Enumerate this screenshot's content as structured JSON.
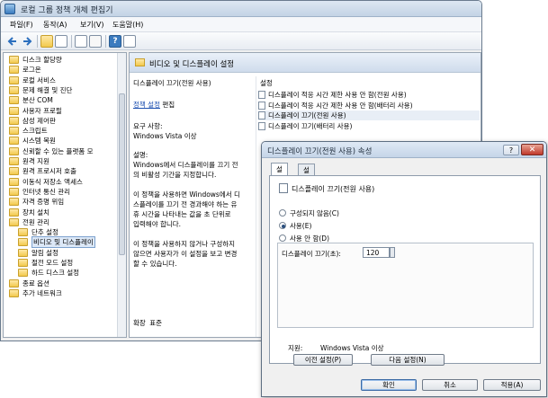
{
  "main_window": {
    "title": "로컬 그룹 정책 개체 편집기",
    "menu": [
      "파일(F)",
      "동작(A)",
      "보기(V)",
      "도움말(H)"
    ]
  },
  "tree": {
    "items": [
      {
        "label": "디스크 할당량"
      },
      {
        "label": "로그온"
      },
      {
        "label": "로컬 서비스"
      },
      {
        "label": "문제 해결 및 진단"
      },
      {
        "label": "분산 COM"
      },
      {
        "label": "사용자 프로필"
      },
      {
        "label": "삼성 제어판"
      },
      {
        "label": "스크립트"
      },
      {
        "label": "시스템 복원"
      },
      {
        "label": "신뢰할 수 있는 플랫폼 모"
      },
      {
        "label": "원격 지원"
      },
      {
        "label": "원격 프로시저 호출"
      },
      {
        "label": "이동식 저장소 액세스"
      },
      {
        "label": "인터넷 통신 관리"
      },
      {
        "label": "자격 증명 위임"
      },
      {
        "label": "장치 설치"
      },
      {
        "label": "전원 관리"
      },
      {
        "label": "단추 설정"
      },
      {
        "label": "비디오 및 디스플레이"
      },
      {
        "label": "알림 설정"
      },
      {
        "label": "절전 모드 설정"
      },
      {
        "label": "하드 디스크 설정"
      },
      {
        "label": "종료 옵션"
      },
      {
        "label": "추가 네트워크"
      }
    ]
  },
  "content": {
    "header": "비디오 및 디스플레이 설정",
    "description": {
      "title": "디스플레이 끄기(전원 사용)",
      "edit_link": "정책 설정",
      "edit_suffix": "편집",
      "req_label": "요구 사항:",
      "req_value": "Windows Vista 이상",
      "desc_label": "설명:",
      "desc_lines": [
        "Windows에서 디스플레이를 끄기 전",
        "의 비활성 기간을 지정합니다.",
        "",
        "이 정책을 사용하면 Windows에서 디",
        "스플레이를 끄기 전 경과해야 하는 유",
        "휴 시간을 나타내는 값을 초 단위로",
        "입력해야 합니다.",
        "",
        "이 정책을 사용하지 않거나 구성하지",
        "않으면 사용자가 이 설정을 보고 변경",
        "할 수 있습니다."
      ]
    },
    "list_header": "설정",
    "list_items": [
      "디스플레이 적응 시간 제한 사용 안 함(전원 사용)",
      "디스플레이 적응 시간 제한 사용 안 함(배터리 사용)",
      "디스플레이 끄기(전원 사용)",
      "디스플레이 끄기(배터리 사용)"
    ],
    "bottom_tabs": [
      "확장",
      "표준"
    ]
  },
  "dialog": {
    "title": "디스플레이 끄기(전원 사용) 속성",
    "help": "?",
    "close": "✕",
    "tabs": [
      "설정",
      "설명"
    ],
    "policy_name": "디스플레이 끄기(전원 사용)",
    "options": [
      "구성되지 않음(C)",
      "사용(E)",
      "사용 안 함(D)"
    ],
    "selected_option": 1,
    "field_label": "디스플레이 끄기(초):",
    "field_value": "120",
    "supported_label": "지원:",
    "supported_value": "Windows Vista 이상",
    "prev_button": "이전 설정(P)",
    "next_button": "다음 설정(N)",
    "ok_button": "확인",
    "cancel_button": "취소",
    "apply_button": "적용(A)"
  }
}
